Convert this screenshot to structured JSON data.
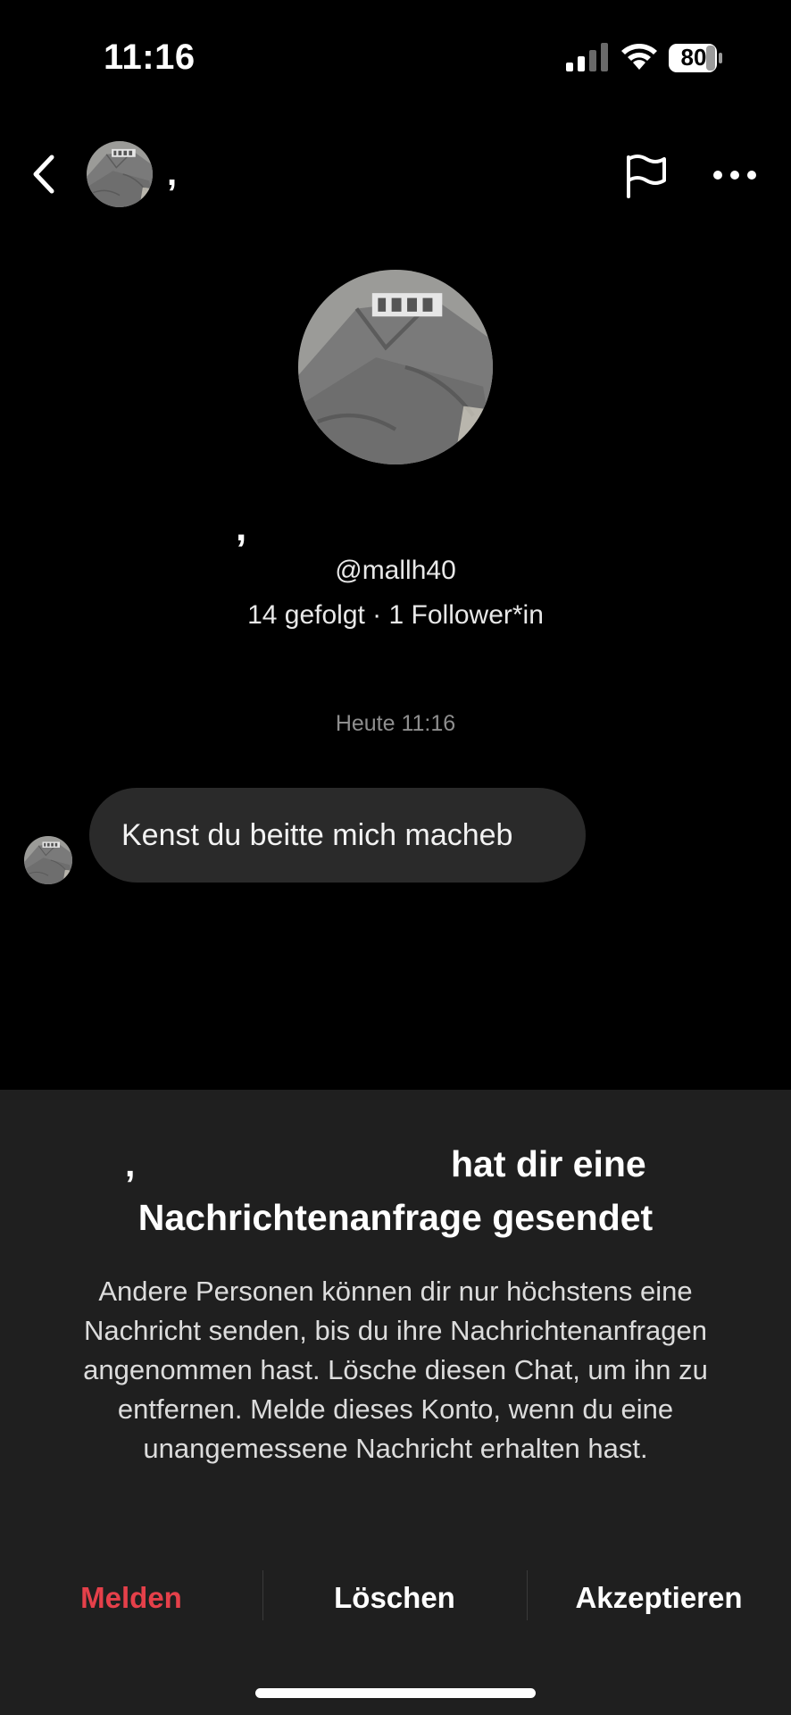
{
  "status_bar": {
    "time": "11:16",
    "battery": "80"
  },
  "header": {
    "name": ","
  },
  "profile": {
    "name": ",",
    "username": "@mallh40",
    "stats": "14 gefolgt · 1 Follower*in"
  },
  "chat": {
    "timestamp": "Heute 11:16",
    "messages": [
      {
        "text": "Kenst du beitte mich macheb"
      }
    ]
  },
  "request_sheet": {
    "title_name": ",",
    "title_rest": "hat dir eine",
    "title_line2": "Nachrichtenanfrage gesendet",
    "body": "Andere Personen können dir nur höchstens eine Nachricht senden, bis du ihre Nachrichtenanfragen angenommen hast. Lösche diesen Chat, um ihn zu entfernen. Melde dieses Konto, wenn du eine unangemessene Nachricht erhalten hast.",
    "actions": {
      "report": "Melden",
      "delete": "Löschen",
      "accept": "Akzeptieren"
    },
    "report_color": "#e5404a"
  }
}
